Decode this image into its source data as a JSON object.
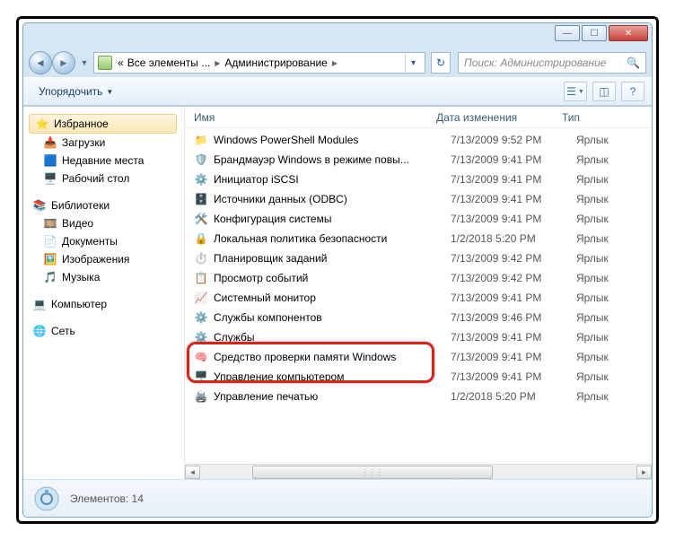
{
  "breadcrumb": {
    "pre": "«",
    "part1": "Все элементы ...",
    "part2": "Администрирование"
  },
  "search": {
    "placeholder": "Поиск: Администрирование"
  },
  "toolbar": {
    "organize": "Упорядочить"
  },
  "sidebar": {
    "favorites": {
      "header": "Избранное",
      "items": [
        "Загрузки",
        "Недавние места",
        "Рабочий стол"
      ]
    },
    "libraries": {
      "header": "Библиотеки",
      "items": [
        "Видео",
        "Документы",
        "Изображения",
        "Музыка"
      ]
    },
    "computer": "Компьютер",
    "network": "Сеть"
  },
  "columns": {
    "name": "Имя",
    "date": "Дата изменения",
    "type": "Тип"
  },
  "files": [
    {
      "name": "Windows PowerShell Modules",
      "date": "7/13/2009 9:52 PM",
      "type": "Ярлык"
    },
    {
      "name": "Брандмауэр Windows в режиме повы...",
      "date": "7/13/2009 9:41 PM",
      "type": "Ярлык"
    },
    {
      "name": "Инициатор iSCSI",
      "date": "7/13/2009 9:41 PM",
      "type": "Ярлык"
    },
    {
      "name": "Источники данных (ODBC)",
      "date": "7/13/2009 9:41 PM",
      "type": "Ярлык"
    },
    {
      "name": "Конфигурация системы",
      "date": "7/13/2009 9:41 PM",
      "type": "Ярлык"
    },
    {
      "name": "Локальная политика безопасности",
      "date": "1/2/2018 5:20 PM",
      "type": "Ярлык"
    },
    {
      "name": "Планировщик заданий",
      "date": "7/13/2009 9:42 PM",
      "type": "Ярлык"
    },
    {
      "name": "Просмотр событий",
      "date": "7/13/2009 9:42 PM",
      "type": "Ярлык"
    },
    {
      "name": "Системный монитор",
      "date": "7/13/2009 9:41 PM",
      "type": "Ярлык"
    },
    {
      "name": "Службы компонентов",
      "date": "7/13/2009 9:46 PM",
      "type": "Ярлык"
    },
    {
      "name": "Службы",
      "date": "7/13/2009 9:41 PM",
      "type": "Ярлык"
    },
    {
      "name": "Средство проверки памяти Windows",
      "date": "7/13/2009 9:41 PM",
      "type": "Ярлык"
    },
    {
      "name": "Управление компьютером",
      "date": "7/13/2009 9:41 PM",
      "type": "Ярлык"
    },
    {
      "name": "Управление печатью",
      "date": "1/2/2018 5:20 PM",
      "type": "Ярлык"
    }
  ],
  "status": {
    "text": "Элементов: 14"
  },
  "highlight_index": 12
}
